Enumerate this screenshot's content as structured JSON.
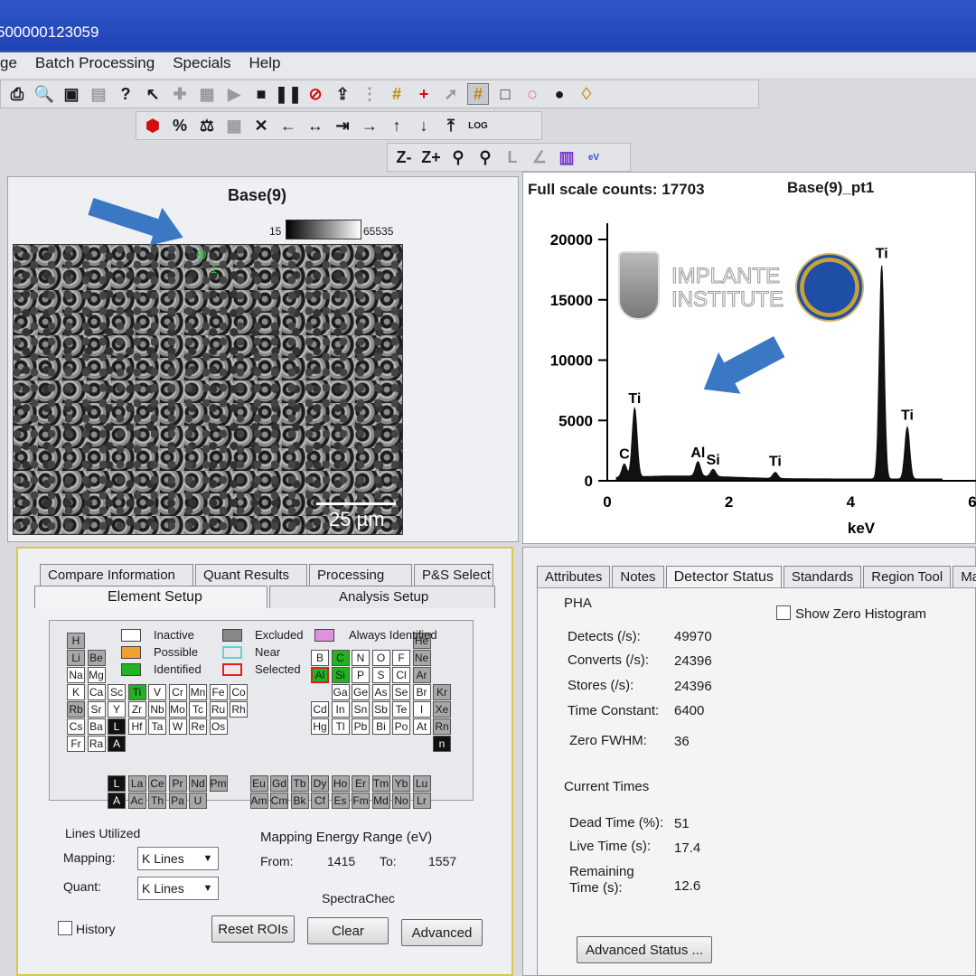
{
  "window": {
    "title": "500000123059"
  },
  "menu": [
    "ge",
    "Batch Processing",
    "Specials",
    "Help"
  ],
  "image_panel": {
    "title": "Base(9)",
    "grey_min": "15",
    "grey_max": "65535",
    "marker_label": "1",
    "scale_bar": "25 µm"
  },
  "spectrum_panel": {
    "full_scale_label": "Full scale counts: 17703",
    "spectrum_name": "Base(9)_pt1",
    "logo_line1": "IMPLANTE",
    "logo_line2": "INSTITUTE"
  },
  "chart_data": {
    "type": "line",
    "title": "",
    "xlabel": "keV",
    "ylabel": "",
    "xlim": [
      0,
      6
    ],
    "ylim": [
      0,
      20000
    ],
    "x_ticks": [
      "0",
      "2",
      "4",
      "6"
    ],
    "y_ticks": [
      "0",
      "5000",
      "10000",
      "15000",
      "20000"
    ],
    "peaks": [
      {
        "label": "C",
        "x": 0.28,
        "y": 1100
      },
      {
        "label": "Ti",
        "x": 0.45,
        "y": 5700
      },
      {
        "label": "Al",
        "x": 1.49,
        "y": 1200
      },
      {
        "label": "Si",
        "x": 1.74,
        "y": 600
      },
      {
        "label": "Ti",
        "x": 2.76,
        "y": 500
      },
      {
        "label": "Ti",
        "x": 4.51,
        "y": 17700
      },
      {
        "label": "Ti",
        "x": 4.93,
        "y": 4300
      }
    ]
  },
  "element_panel": {
    "tabs_top": [
      "Compare Information",
      "Quant Results",
      "Processing",
      "P&S Select"
    ],
    "tabs_bottom": [
      "Element Setup",
      "Analysis Setup"
    ],
    "legend": {
      "inactive": "Inactive",
      "possible": "Possible",
      "identified": "Identified",
      "excluded": "Excluded",
      "near": "Near",
      "selected": "Selected",
      "always": "Always Identified"
    },
    "lines_utilized": "Lines Utilized",
    "mapping_label": "Mapping:",
    "mapping_value": "K Lines",
    "quant_label": "Quant:",
    "quant_value": "K Lines",
    "energy_range_label": "Mapping Energy Range (eV)",
    "from_label": "From:",
    "from_value": "1415",
    "to_label": "To:",
    "to_value": "1557",
    "spectrachec": "SpectraChec",
    "history_label": "History",
    "reset_button": "Reset ROIs",
    "clear_button": "Clear",
    "advanced_button": "Advanced"
  },
  "detector_panel": {
    "tabs": [
      "Attributes",
      "Notes",
      "Detector Status",
      "Standards",
      "Region Tool",
      "Mat"
    ],
    "pha": "PHA",
    "show_zero": "Show Zero Histogram",
    "rows": [
      {
        "label": "Detects (/s):",
        "value": "49970"
      },
      {
        "label": "Converts (/s):",
        "value": "24396"
      },
      {
        "label": "Stores (/s):",
        "value": "24396"
      },
      {
        "label": "Time Constant:",
        "value": "6400"
      },
      {
        "label": "Zero FWHM:",
        "value": "36"
      }
    ],
    "current_times": "Current Times",
    "times": [
      {
        "label": "Dead Time (%):",
        "value": "51"
      },
      {
        "label": "Live Time (s):",
        "value": "17.4"
      },
      {
        "label": "Remaining",
        "value": ""
      },
      {
        "label": "Time (s):",
        "value": "12.6"
      }
    ],
    "advanced_status": "Advanced Status ..."
  }
}
